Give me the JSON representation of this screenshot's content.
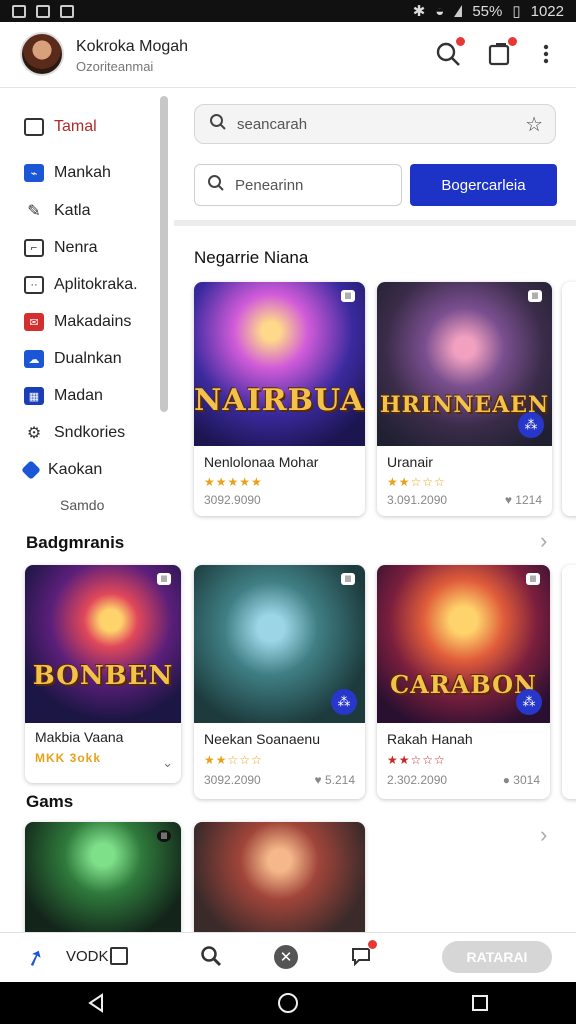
{
  "status_bar": {
    "battery": "55%",
    "time": "1022"
  },
  "header": {
    "user_name": "Kokroka Mogah",
    "user_subtitle": "Ozoriteanmai"
  },
  "sidebar": {
    "items": [
      {
        "label": "Tamal",
        "icon": "bag-icon",
        "color": "#333333"
      },
      {
        "label": "Mankah",
        "icon": "controller-icon",
        "color": "#1a56d6"
      },
      {
        "label": "Katla",
        "icon": "pencil-icon",
        "color": "#333333"
      },
      {
        "label": "Nenra",
        "icon": "frame-icon",
        "color": "#333333"
      },
      {
        "label": "Aplitokraka.",
        "icon": "puzzle-icon",
        "color": "#333333"
      },
      {
        "label": "Makadains",
        "icon": "chat-icon",
        "color": "#d32f2f"
      },
      {
        "label": "Dualnkan",
        "icon": "cloud-icon",
        "color": "#1a56d6"
      },
      {
        "label": "Madan",
        "icon": "grid-icon",
        "color": "#1a3db8"
      },
      {
        "label": "Sndkories",
        "icon": "gear-icon",
        "color": "#333333"
      },
      {
        "label": "Kaokan",
        "icon": "tag-icon",
        "color": "#1a56d6"
      }
    ],
    "more_label": "Samdo",
    "section_title": "Badgmranis",
    "side_card": {
      "name": "Makbia Vaana",
      "rating_text": "MKK 3okk",
      "art_title": "BONBEN"
    },
    "games_title": "Gams"
  },
  "search": {
    "placeholder": "seancarah",
    "secondary_placeholder": "Penearinn",
    "button_label": "Bogercarleia"
  },
  "main": {
    "section_title": "Negarrie Niana",
    "row1": [
      {
        "name": "Nenlolonaa Mohar",
        "stars": "★★★★★",
        "price": "3092.9090",
        "meta": "",
        "art_title": "NAIRBUAN",
        "badge": "lll"
      },
      {
        "name": "Uranair",
        "stars": "★★☆☆☆",
        "price": "3.091.2090",
        "meta": "♥ 1214",
        "art_title": "HRINNEAEN",
        "badge": "lll"
      }
    ],
    "row2": [
      {
        "name": "Neekan Soanaenu",
        "stars": "★★☆☆☆",
        "price": "3092.2090",
        "meta": "♥ 5.214",
        "art_title": "",
        "badge": "lll"
      },
      {
        "name": "Rakah Hanah",
        "stars": "★★☆☆☆",
        "price": "2.302.2090",
        "meta": "● 3014",
        "art_title": "CARABON",
        "badge": "lll"
      }
    ]
  },
  "bottom_nav": {
    "label": "VODK",
    "rate_button": "RATARAI"
  }
}
